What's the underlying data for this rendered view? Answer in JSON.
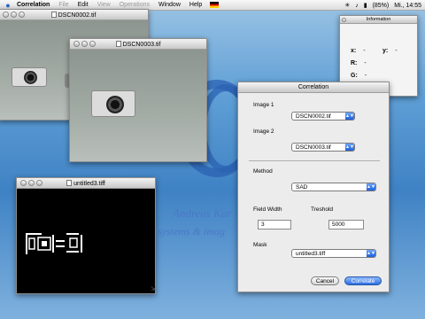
{
  "menubar": {
    "apple_icon": "apple-icon",
    "items": [
      {
        "label": "Correlation",
        "bold": true,
        "dim": false
      },
      {
        "label": "File",
        "bold": false,
        "dim": true
      },
      {
        "label": "Edit",
        "bold": false,
        "dim": false
      },
      {
        "label": "View",
        "bold": false,
        "dim": true
      },
      {
        "label": "Operations",
        "bold": false,
        "dim": true
      },
      {
        "label": "Window",
        "bold": false,
        "dim": false
      },
      {
        "label": "Help",
        "bold": false,
        "dim": false
      }
    ],
    "battery": "(85%)",
    "clock": "Mi., 14:55"
  },
  "background": {
    "line1": "Andreas Kar",
    "line2": "systems & imag"
  },
  "windows": {
    "image1": {
      "title": "DSCN0002.tif"
    },
    "image2": {
      "title": "DSCN0003.tif"
    },
    "mask": {
      "title": "untitled3.tiff"
    },
    "info": {
      "title": "Information",
      "x_label": "x:",
      "x_value": "-",
      "y_label": "y:",
      "y_value": "-",
      "r_label": "R:",
      "r_value": "-",
      "g_label": "G:",
      "g_value": "-"
    }
  },
  "dialog": {
    "title": "Correlation",
    "image1_label": "Image 1",
    "image1_value": "DSCN0002.tif",
    "image2_label": "Image 2",
    "image2_value": "DSCN0003.tif",
    "method_label": "Method",
    "method_value": "SAD",
    "field_width_label": "Field Width",
    "field_width_value": "3",
    "threshold_label": "Treshold",
    "threshold_value": "5000",
    "mask_label": "Mask",
    "mask_value": "untitled3.tiff",
    "cancel_label": "Cancel",
    "ok_label": "Correlate"
  },
  "colors": {
    "desktop_blue": "#3f82c4",
    "default_button": "#2c6fe0"
  }
}
